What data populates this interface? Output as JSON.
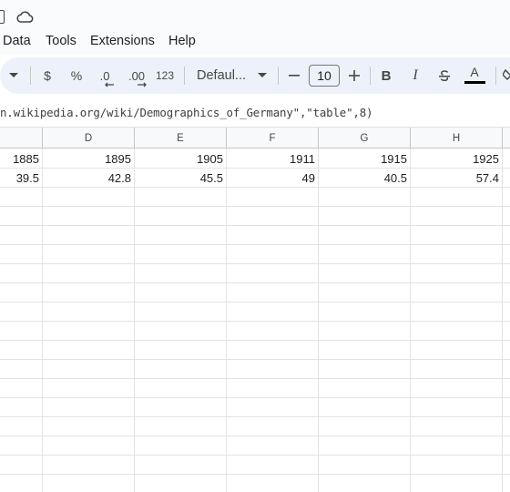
{
  "menu": {
    "items": [
      {
        "label": "Data"
      },
      {
        "label": "Tools"
      },
      {
        "label": "Extensions"
      },
      {
        "label": "Help"
      }
    ]
  },
  "toolbar": {
    "currency": "$",
    "percent": "%",
    "decrease_decimal": ".0",
    "increase_decimal": ".00",
    "number_format": "123",
    "font": "Defaul...",
    "font_size": "10",
    "bold": "B",
    "italic": "I",
    "text_color": "A"
  },
  "formula": {
    "text": "n.wikipedia.org/wiki/Demographics_of_Germany\",\"table\",8)"
  },
  "columns": [
    "",
    "D",
    "E",
    "F",
    "G",
    "H"
  ],
  "rows": [
    [
      "1885",
      "1895",
      "1905",
      "1911",
      "1915",
      "1925"
    ],
    [
      "39.5",
      "42.8",
      "45.5",
      "49",
      "40.5",
      "57.4"
    ]
  ],
  "colors": {
    "toolbar_bg": "#edf2fa",
    "header_bg": "#f8f9fa",
    "grid_line": "#e2e3e3"
  }
}
